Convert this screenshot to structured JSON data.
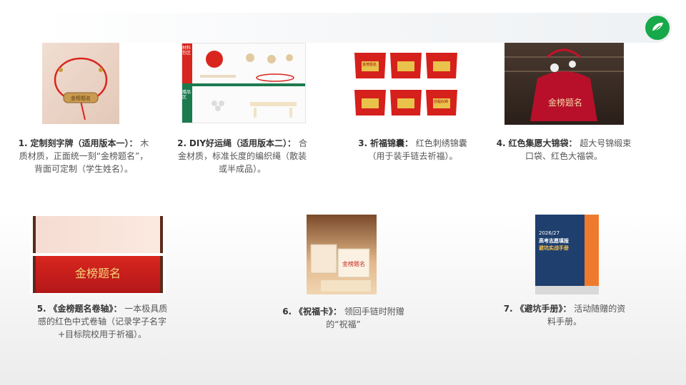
{
  "brand": {
    "logo_icon": "green-leaf-logo-icon"
  },
  "items": [
    {
      "num": "1.",
      "title": "定制刻字牌（适用版本一）：",
      "desc": "木质材质，正面统一刻“金榜题名”，背面可定制（学生姓名）。",
      "img_text": "金榜题名"
    },
    {
      "num": "2.",
      "title": "DIY好运绳（适用版本二）：",
      "desc": "合金材质，标准长度的编织绳（散装或半成品）。",
      "img_text": [
        "材料包区",
        "赠品区"
      ]
    },
    {
      "num": "3.",
      "title": "祈福锦囊：",
      "desc": "红色刺绣锦囊（用于装手链去祈福）。",
      "img_text": [
        "金榜题名",
        "前程似锦"
      ]
    },
    {
      "num": "4.",
      "title": "红色集愿大锦袋：",
      "desc": "超大号锦缎束口袋、红色大福袋。",
      "img_text": "金榜题名"
    },
    {
      "num": "5.",
      "title": "《金榜题名卷轴》：",
      "desc": "一本极具质感的红色中式卷轴（记录学子名字+目标院校用于祈福）。",
      "img_text": "金榜题名"
    },
    {
      "num": "6.",
      "title": "《祝福卡》：",
      "desc": "领回手链时附赠的“祝福”",
      "img_text": "金榜题名"
    },
    {
      "num": "7.",
      "title": "《避坑手册》：",
      "desc": "活动随赠的资料手册。",
      "img_text": [
        "2026/27",
        "高考志愿填报",
        "避坑实战手册"
      ]
    }
  ]
}
